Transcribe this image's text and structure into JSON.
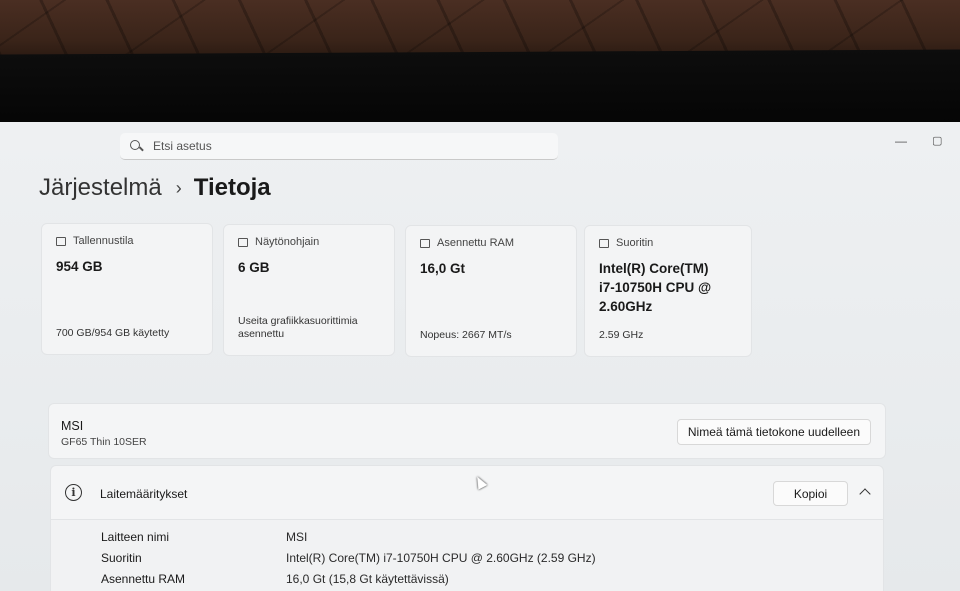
{
  "search": {
    "placeholder": "Etsi asetus"
  },
  "window_controls": {
    "minimize": "—",
    "maximize": "▢"
  },
  "breadcrumb": {
    "parent": "Järjestelmä",
    "separator": "›",
    "current": "Tietoja"
  },
  "cards": [
    {
      "label": "Tallennustila",
      "value": "954 GB",
      "sub": "700 GB/954 GB käytetty",
      "icon": "storage-icon"
    },
    {
      "label": "Näytönohjain",
      "value": "6 GB",
      "sub": "Useita grafiikkasuorittimia asennettu",
      "icon": "display-adapter-icon"
    },
    {
      "label": "Asennettu RAM",
      "value": "16,0 Gt",
      "sub": "Nopeus: 2667 MT/s",
      "icon": "ram-icon"
    },
    {
      "label": "Suoritin",
      "value": "Intel(R) Core(TM) i7-10750H CPU @ 2.60GHz",
      "sub": "2.59 GHz",
      "icon": "processor-icon"
    }
  ],
  "device": {
    "name": "MSI",
    "model": "GF65 Thin 10SER",
    "rename_label": "Nimeä tämä tietokone uudelleen"
  },
  "specs": {
    "title": "Laitemääritykset",
    "copy_label": "Kopioi",
    "rows": [
      {
        "label": "Laitteen nimi",
        "value": "MSI"
      },
      {
        "label": "Suoritin",
        "value": "Intel(R) Core(TM) i7-10750H CPU @ 2.60GHz (2.59 GHz)"
      },
      {
        "label": "Asennettu RAM",
        "value": "16,0 Gt (15,8 Gt käytettävissä)"
      }
    ]
  }
}
